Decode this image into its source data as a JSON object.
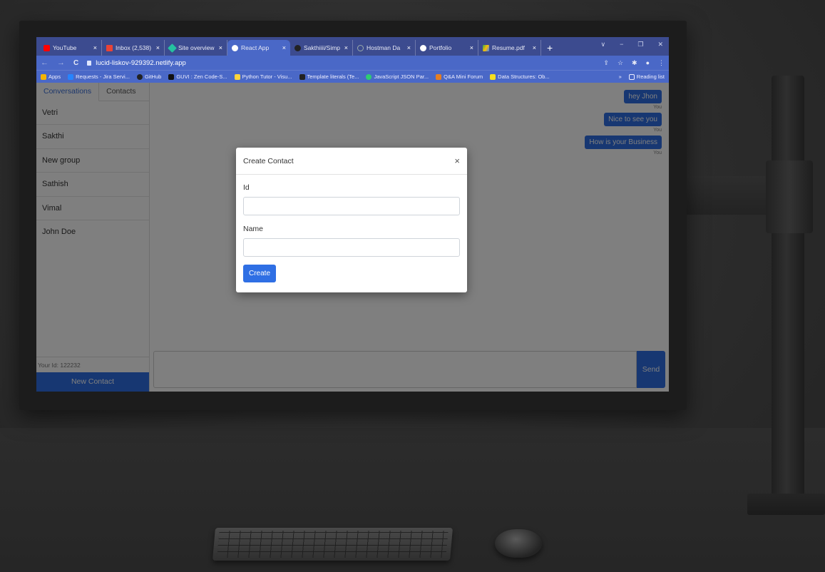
{
  "browser": {
    "tabs": [
      {
        "label": "YouTube",
        "favicon_color": "#ff0000",
        "active": false
      },
      {
        "label": "Inbox (2,538)",
        "favicon_color": "#ea4335",
        "active": false
      },
      {
        "label": "Site overview",
        "favicon_color": "#25c2a0",
        "active": false
      },
      {
        "label": "React App",
        "favicon_color": "#ffffff",
        "active": true
      },
      {
        "label": "Sakthiiii/Simp",
        "favicon_color": "#222222",
        "active": false
      },
      {
        "label": "Hostman Da",
        "favicon_color": "#3c4b8f",
        "active": false
      },
      {
        "label": "Portfolio",
        "favicon_color": "#ffffff",
        "active": false
      },
      {
        "label": "Resume.pdf",
        "favicon_color": "#f4b400",
        "active": false
      }
    ],
    "new_tab": "+",
    "tab_close": "×",
    "window_controls": {
      "dropdown": "∨",
      "minimize": "−",
      "restore": "❐",
      "close": "✕"
    },
    "nav": {
      "back": "←",
      "forward": "→",
      "reload": "C"
    },
    "url": "lucid-liskov-929392.netlify.app",
    "toolbar_icons": {
      "share": "⇪",
      "star": "☆",
      "extensions": "✱",
      "profile": "●",
      "menu": "⋮"
    },
    "bookmarks": [
      {
        "label": "Apps",
        "icon_color": "#f4b400"
      },
      {
        "label": "Requests - Jira Servi...",
        "icon_color": "#2684ff"
      },
      {
        "label": "GitHub",
        "icon_color": "#222222"
      },
      {
        "label": "GUVI : Zen Code-S...",
        "icon_color": "#111111"
      },
      {
        "label": "Python Tutor - Visu...",
        "icon_color": "#ffd43b"
      },
      {
        "label": "Template literals (Te...",
        "icon_color": "#222222"
      },
      {
        "label": "JavaScript JSON Par...",
        "icon_color": "#2ecc71"
      },
      {
        "label": "Q&A Mini Forum",
        "icon_color": "#e67e22"
      },
      {
        "label": "Data Structures: Ob...",
        "icon_color": "#f7df1e"
      }
    ],
    "bookmarks_more": "»",
    "reading_list": "Reading list"
  },
  "app": {
    "sidebar": {
      "tabs": [
        {
          "label": "Conversations",
          "active": true
        },
        {
          "label": "Contacts",
          "active": false
        }
      ],
      "contacts": [
        "Vetri",
        "Sakthi",
        "New group",
        "Sathish",
        "Vimal",
        "John Doe"
      ],
      "your_id": "Your Id: 122232",
      "new_contact": "New Contact"
    },
    "messages": [
      {
        "text": "hey Jhon",
        "sender": "You"
      },
      {
        "text": "Nice to see you",
        "sender": "You"
      },
      {
        "text": "How is your Business",
        "sender": "You"
      }
    ],
    "composer": {
      "send_label": "Send",
      "value": ""
    }
  },
  "modal": {
    "title": "Create Contact",
    "close": "×",
    "id_label": "Id",
    "id_value": "",
    "name_label": "Name",
    "name_value": "",
    "create_label": "Create"
  },
  "colors": {
    "chrome_bar": "#4a68c7",
    "tab_strip": "#3c4b8f",
    "primary": "#2f6fe4"
  }
}
